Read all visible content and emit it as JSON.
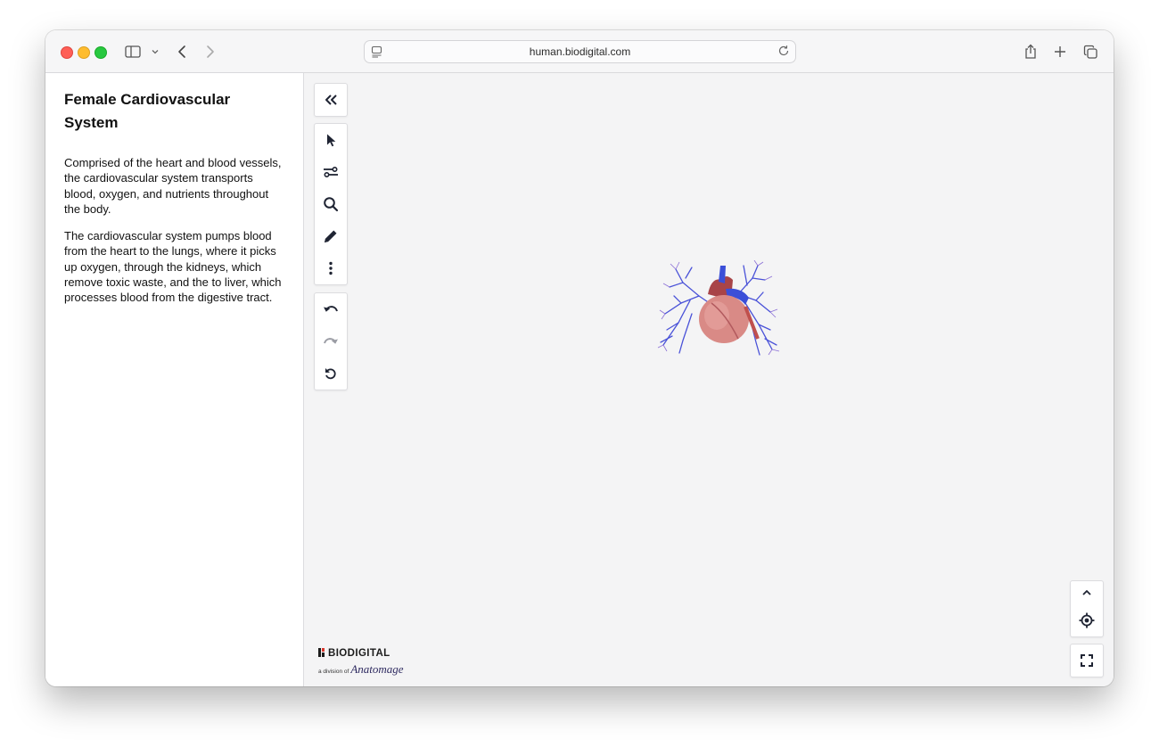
{
  "browser": {
    "url": "human.biodigital.com"
  },
  "sidebar": {
    "title": "Female Cardiovascular System",
    "paragraphs": [
      "Comprised of the heart and blood vessels, the cardiovascular system transports blood, oxygen, and nutrients throughout the body.",
      "The cardiovascular system pumps blood from the heart to the lungs, where it picks up oxygen, through the kidneys, which remove toxic waste, and the to liver, which processes blood from the digestive tract."
    ]
  },
  "toolbar": {
    "collapse_icon": "double-chevron-left-icon",
    "tools": [
      "select-arrow-icon",
      "sliders-icon",
      "search-icon",
      "pencil-icon",
      "more-vertical-icon"
    ],
    "history": [
      "undo-icon",
      "redo-icon",
      "reset-icon"
    ]
  },
  "controls": {
    "camera": [
      "chevron-up-icon",
      "locate-icon"
    ],
    "fullscreen": "fullscreen-icon"
  },
  "logo": {
    "brand": "BIODIGITAL",
    "division": "a division of",
    "parent": "Anatomage"
  },
  "colors": {
    "viewer_bg": "#f4f4f5",
    "icon": "#1f2433",
    "vein_blue": "#3b4fd8",
    "heart_pink": "#d98a86"
  }
}
